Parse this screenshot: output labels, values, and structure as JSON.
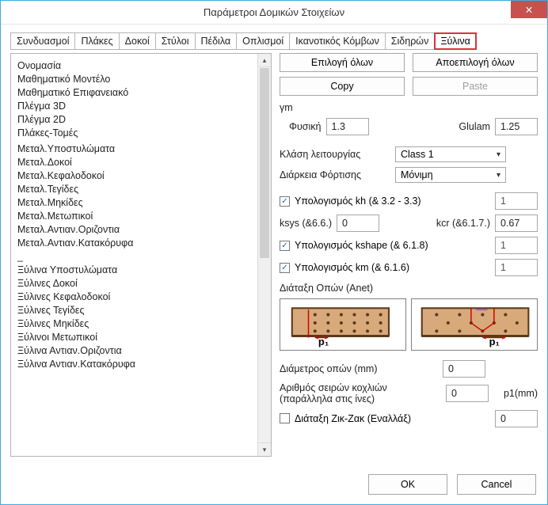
{
  "window": {
    "title": "Παράμετροι Δομικών Στοιχείων"
  },
  "tabs": [
    "Συνδυασμοί",
    "Πλάκες",
    "Δοκοί",
    "Στύλοι",
    "Πέδιλα",
    "Οπλισμοί",
    "Ικανοτικός Κόμβων",
    "Σιδηρών",
    "Ξύλινα"
  ],
  "active_tab": "Ξύλινα",
  "left_list": [
    "Ονομασία",
    "Μαθηματικό Μοντέλο",
    "Μαθηματικό Επιφανειακό",
    "Πλέγμα 3D",
    "Πλέγμα 2D",
    "Πλάκες-Τομές",
    "",
    "Μεταλ.Υποστυλώματα",
    "Μεταλ.Δοκοί",
    "Μεταλ.Κεφαλοδοκοί",
    "Μεταλ.Τεγίδες",
    "Μεταλ.Μηκίδες",
    "Μεταλ.Μετωπικοί",
    "Μεταλ.Αντιαν.Οριζοντια",
    "Μεταλ.Αντιαν.Κατακόρυφα",
    "_",
    "Ξύλινα Υποστυλώματα",
    "Ξύλινες Δοκοί",
    "Ξύλινες Κεφαλοδοκοί",
    "Ξύλινες Τεγίδες",
    "Ξύλινες Μηκίδες",
    "Ξύλινοι Μετωπικοί",
    "Ξύλινα Αντιαν.Οριζοντια",
    "Ξύλινα Αντιαν.Κατακόρυφα"
  ],
  "buttons": {
    "select_all": "Επιλογή όλων",
    "deselect_all": "Αποεπιλογή όλων",
    "copy": "Copy",
    "paste": "Paste",
    "ok": "OK",
    "cancel": "Cancel"
  },
  "gm": {
    "label": "γm",
    "physiki_label": "Φυσική",
    "physiki_value": "1.3",
    "glulam_label": "Glulam",
    "glulam_value": "1.25"
  },
  "operation": {
    "class_label": "Κλάση λειτουργίας",
    "class_value": "Class 1",
    "duration_label": "Διάρκεια Φόρτισης",
    "duration_value": "Μόνιμη"
  },
  "calcs": {
    "kh_checked": true,
    "kh_label": "Υπολογισμός kh (& 3.2 - 3.3)",
    "kh_value": "1",
    "ksys_label": "ksys (&6.6.)",
    "ksys_value": "0",
    "kcr_label": "kcr  (&6.1.7.)",
    "kcr_value": "0.67",
    "kshape_checked": true,
    "kshape_label": "Υπολογισμός kshape (& 6.1.8)",
    "kshape_value": "1",
    "km_checked": true,
    "km_label": "Υπολογισμός km (& 6.1.6)",
    "km_value": "1"
  },
  "anet": {
    "group_label": "Διάταξη Οπών (Anet)",
    "diam_label": "Διάμετρος οπών (mm)",
    "diam_value": "0",
    "rows_label": "Αριθμός σειρών κοχλιών (παράλληλα στις ίνες)",
    "rows_value": "0",
    "p1_label": "p1(mm)",
    "zigzag_checked": false,
    "zigzag_label": "Διάταξη Ζικ-Ζακ (Εναλλάξ)",
    "zigzag_value": "0",
    "p1_annot": "p₁"
  }
}
